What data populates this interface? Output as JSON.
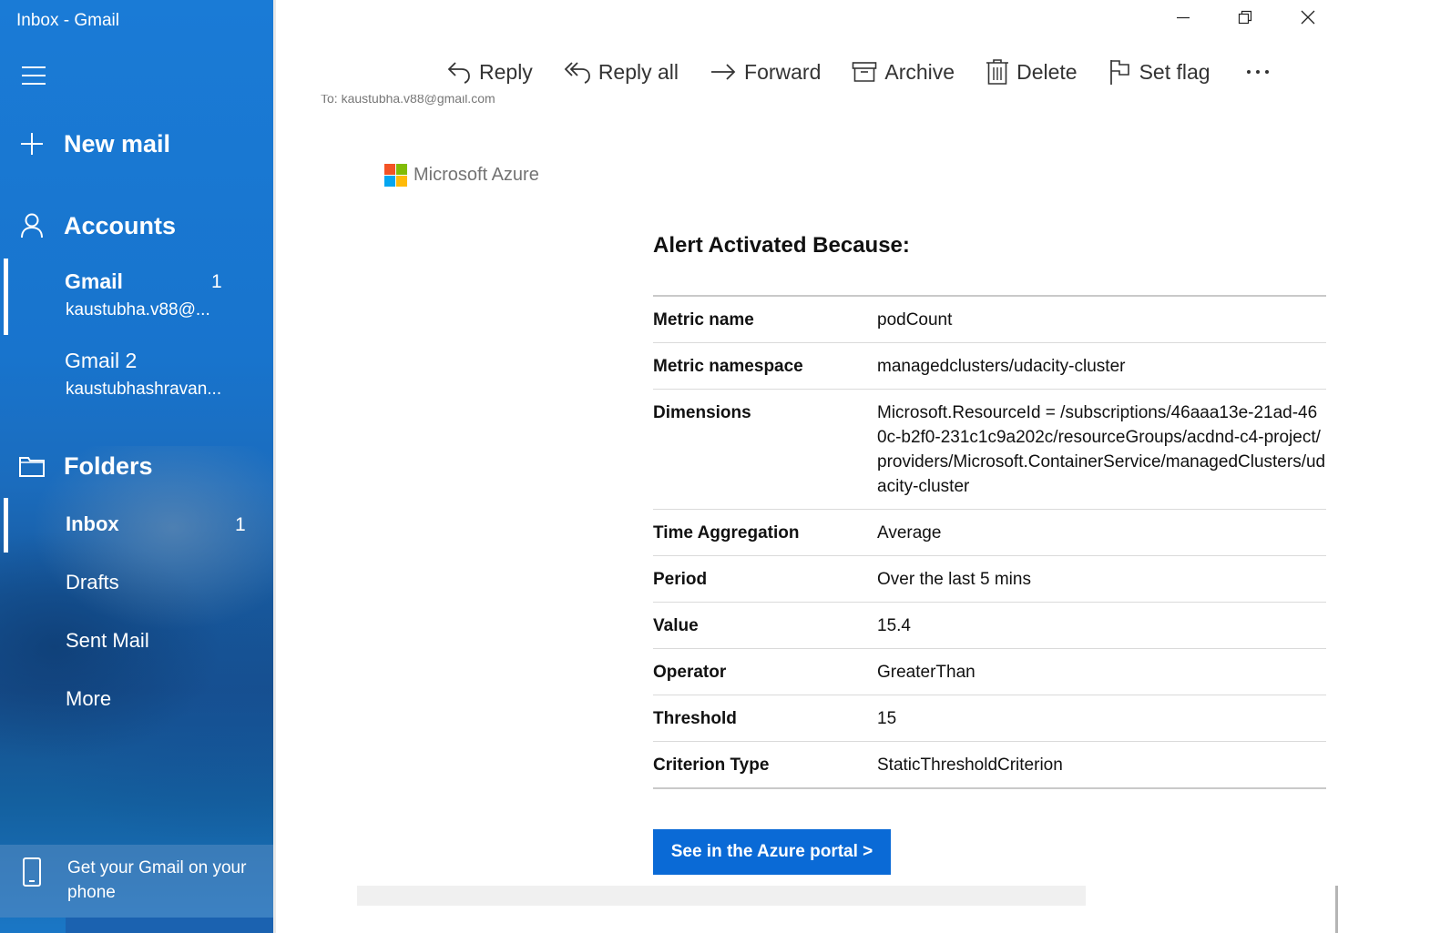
{
  "window": {
    "title": "Inbox - Gmail"
  },
  "sidebar": {
    "new_mail_label": "New mail",
    "accounts_label": "Accounts",
    "accounts": [
      {
        "name": "Gmail",
        "email": "kaustubha.v88@...",
        "count": "1"
      },
      {
        "name": "Gmail 2",
        "email": "kaustubhashravan..."
      }
    ],
    "folders_label": "Folders",
    "folders": [
      {
        "name": "Inbox",
        "count": "1"
      },
      {
        "name": "Drafts"
      },
      {
        "name": "Sent Mail"
      },
      {
        "name": "More"
      }
    ],
    "phone_promo": "Get your Gmail on your phone"
  },
  "toolbar": {
    "reply": "Reply",
    "reply_all": "Reply all",
    "forward": "Forward",
    "archive": "Archive",
    "delete": "Delete",
    "set_flag": "Set flag"
  },
  "email": {
    "to_line": "To: kaustubha.v88@gmail.com",
    "brand": "Microsoft Azure",
    "alert_title": "Alert Activated Because:",
    "rows": [
      {
        "key": "Metric name",
        "value": "podCount"
      },
      {
        "key": "Metric namespace",
        "value": "managedclusters/udacity-cluster"
      },
      {
        "key": "Dimensions",
        "value": "Microsoft.ResourceId = /subscriptions/46aaa13e-21ad-460c-b2f0-231c1c9a202c/resourceGroups/acdnd-c4-project/providers/Microsoft.ContainerService/managedClusters/udacity-cluster"
      },
      {
        "key": "Time Aggregation",
        "value": "Average"
      },
      {
        "key": "Period",
        "value": "Over the last 5 mins"
      },
      {
        "key": "Value",
        "value": "15.4"
      },
      {
        "key": "Operator",
        "value": "GreaterThan"
      },
      {
        "key": "Threshold",
        "value": "15"
      },
      {
        "key": "Criterion Type",
        "value": "StaticThresholdCriterion"
      }
    ],
    "portal_button": "See in the Azure portal >"
  },
  "colors": {
    "sidebar_blue": "#1a7bd6",
    "portal_button": "#0a6ad6",
    "ms_red": "#f35325",
    "ms_green": "#81bc06",
    "ms_blue": "#05a6f0",
    "ms_yellow": "#ffba08"
  }
}
